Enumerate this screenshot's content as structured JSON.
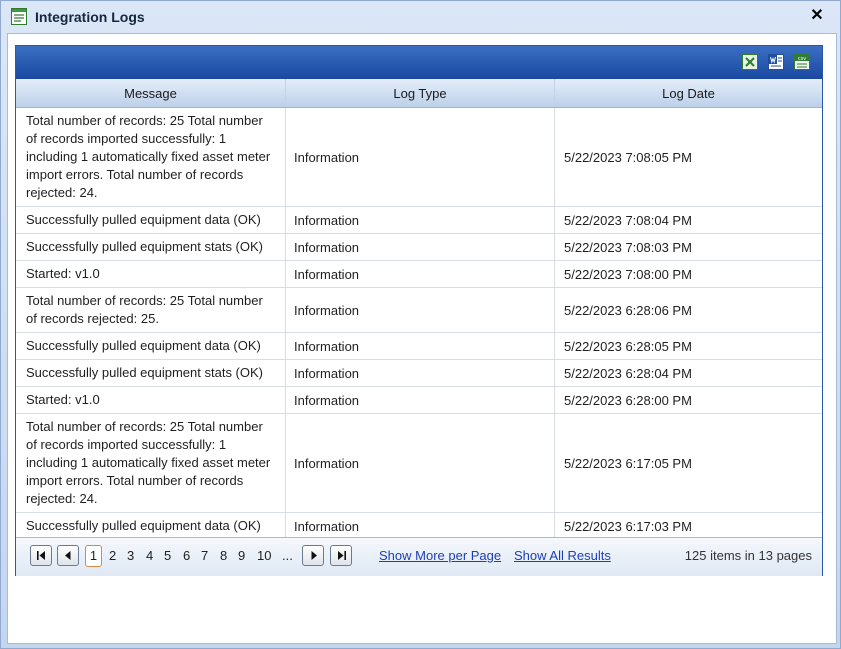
{
  "window": {
    "title": "Integration Logs",
    "close_symbol": "✕"
  },
  "toolbar": {
    "icons": [
      "excel-export-icon",
      "word-export-icon",
      "csv-export-icon"
    ],
    "csv_label": "csv"
  },
  "columns": [
    "Message",
    "Log Type",
    "Log Date"
  ],
  "rows": [
    {
      "message": "Total number of records: 25 Total number of records imported successfully: 1 including 1 automatically fixed asset meter import errors. Total number of records rejected: 24.",
      "type": "Information",
      "date": "5/22/2023 7:08:05 PM"
    },
    {
      "message": "Successfully pulled equipment data (OK)",
      "type": "Information",
      "date": "5/22/2023 7:08:04 PM"
    },
    {
      "message": "Successfully pulled equipment stats (OK)",
      "type": "Information",
      "date": "5/22/2023 7:08:03 PM"
    },
    {
      "message": "Started: v1.0",
      "type": "Information",
      "date": "5/22/2023 7:08:00 PM"
    },
    {
      "message": "Total number of records: 25 Total number of records rejected: 25.",
      "type": "Information",
      "date": "5/22/2023 6:28:06 PM"
    },
    {
      "message": "Successfully pulled equipment data (OK)",
      "type": "Information",
      "date": "5/22/2023 6:28:05 PM"
    },
    {
      "message": "Successfully pulled equipment stats (OK)",
      "type": "Information",
      "date": "5/22/2023 6:28:04 PM"
    },
    {
      "message": "Started: v1.0",
      "type": "Information",
      "date": "5/22/2023 6:28:00 PM"
    },
    {
      "message": "Total number of records: 25 Total number of records imported successfully: 1 including 1 automatically fixed asset meter import errors. Total number of records rejected: 24.",
      "type": "Information",
      "date": "5/22/2023 6:17:05 PM"
    },
    {
      "message": "Successfully pulled equipment data (OK)",
      "type": "Information",
      "date": "5/22/2023 6:17:03 PM"
    }
  ],
  "pager": {
    "current": "1",
    "pages": [
      "2",
      "3",
      "4",
      "5",
      "6",
      "7",
      "8",
      "9",
      "10",
      "..."
    ],
    "show_more": "Show More per Page",
    "show_all": "Show All Results",
    "info": "125 items in 13 pages"
  },
  "colors": {
    "toolbar": "#1a48a0",
    "link": "#1d3fb5",
    "current_page_border": "#d8894a"
  }
}
